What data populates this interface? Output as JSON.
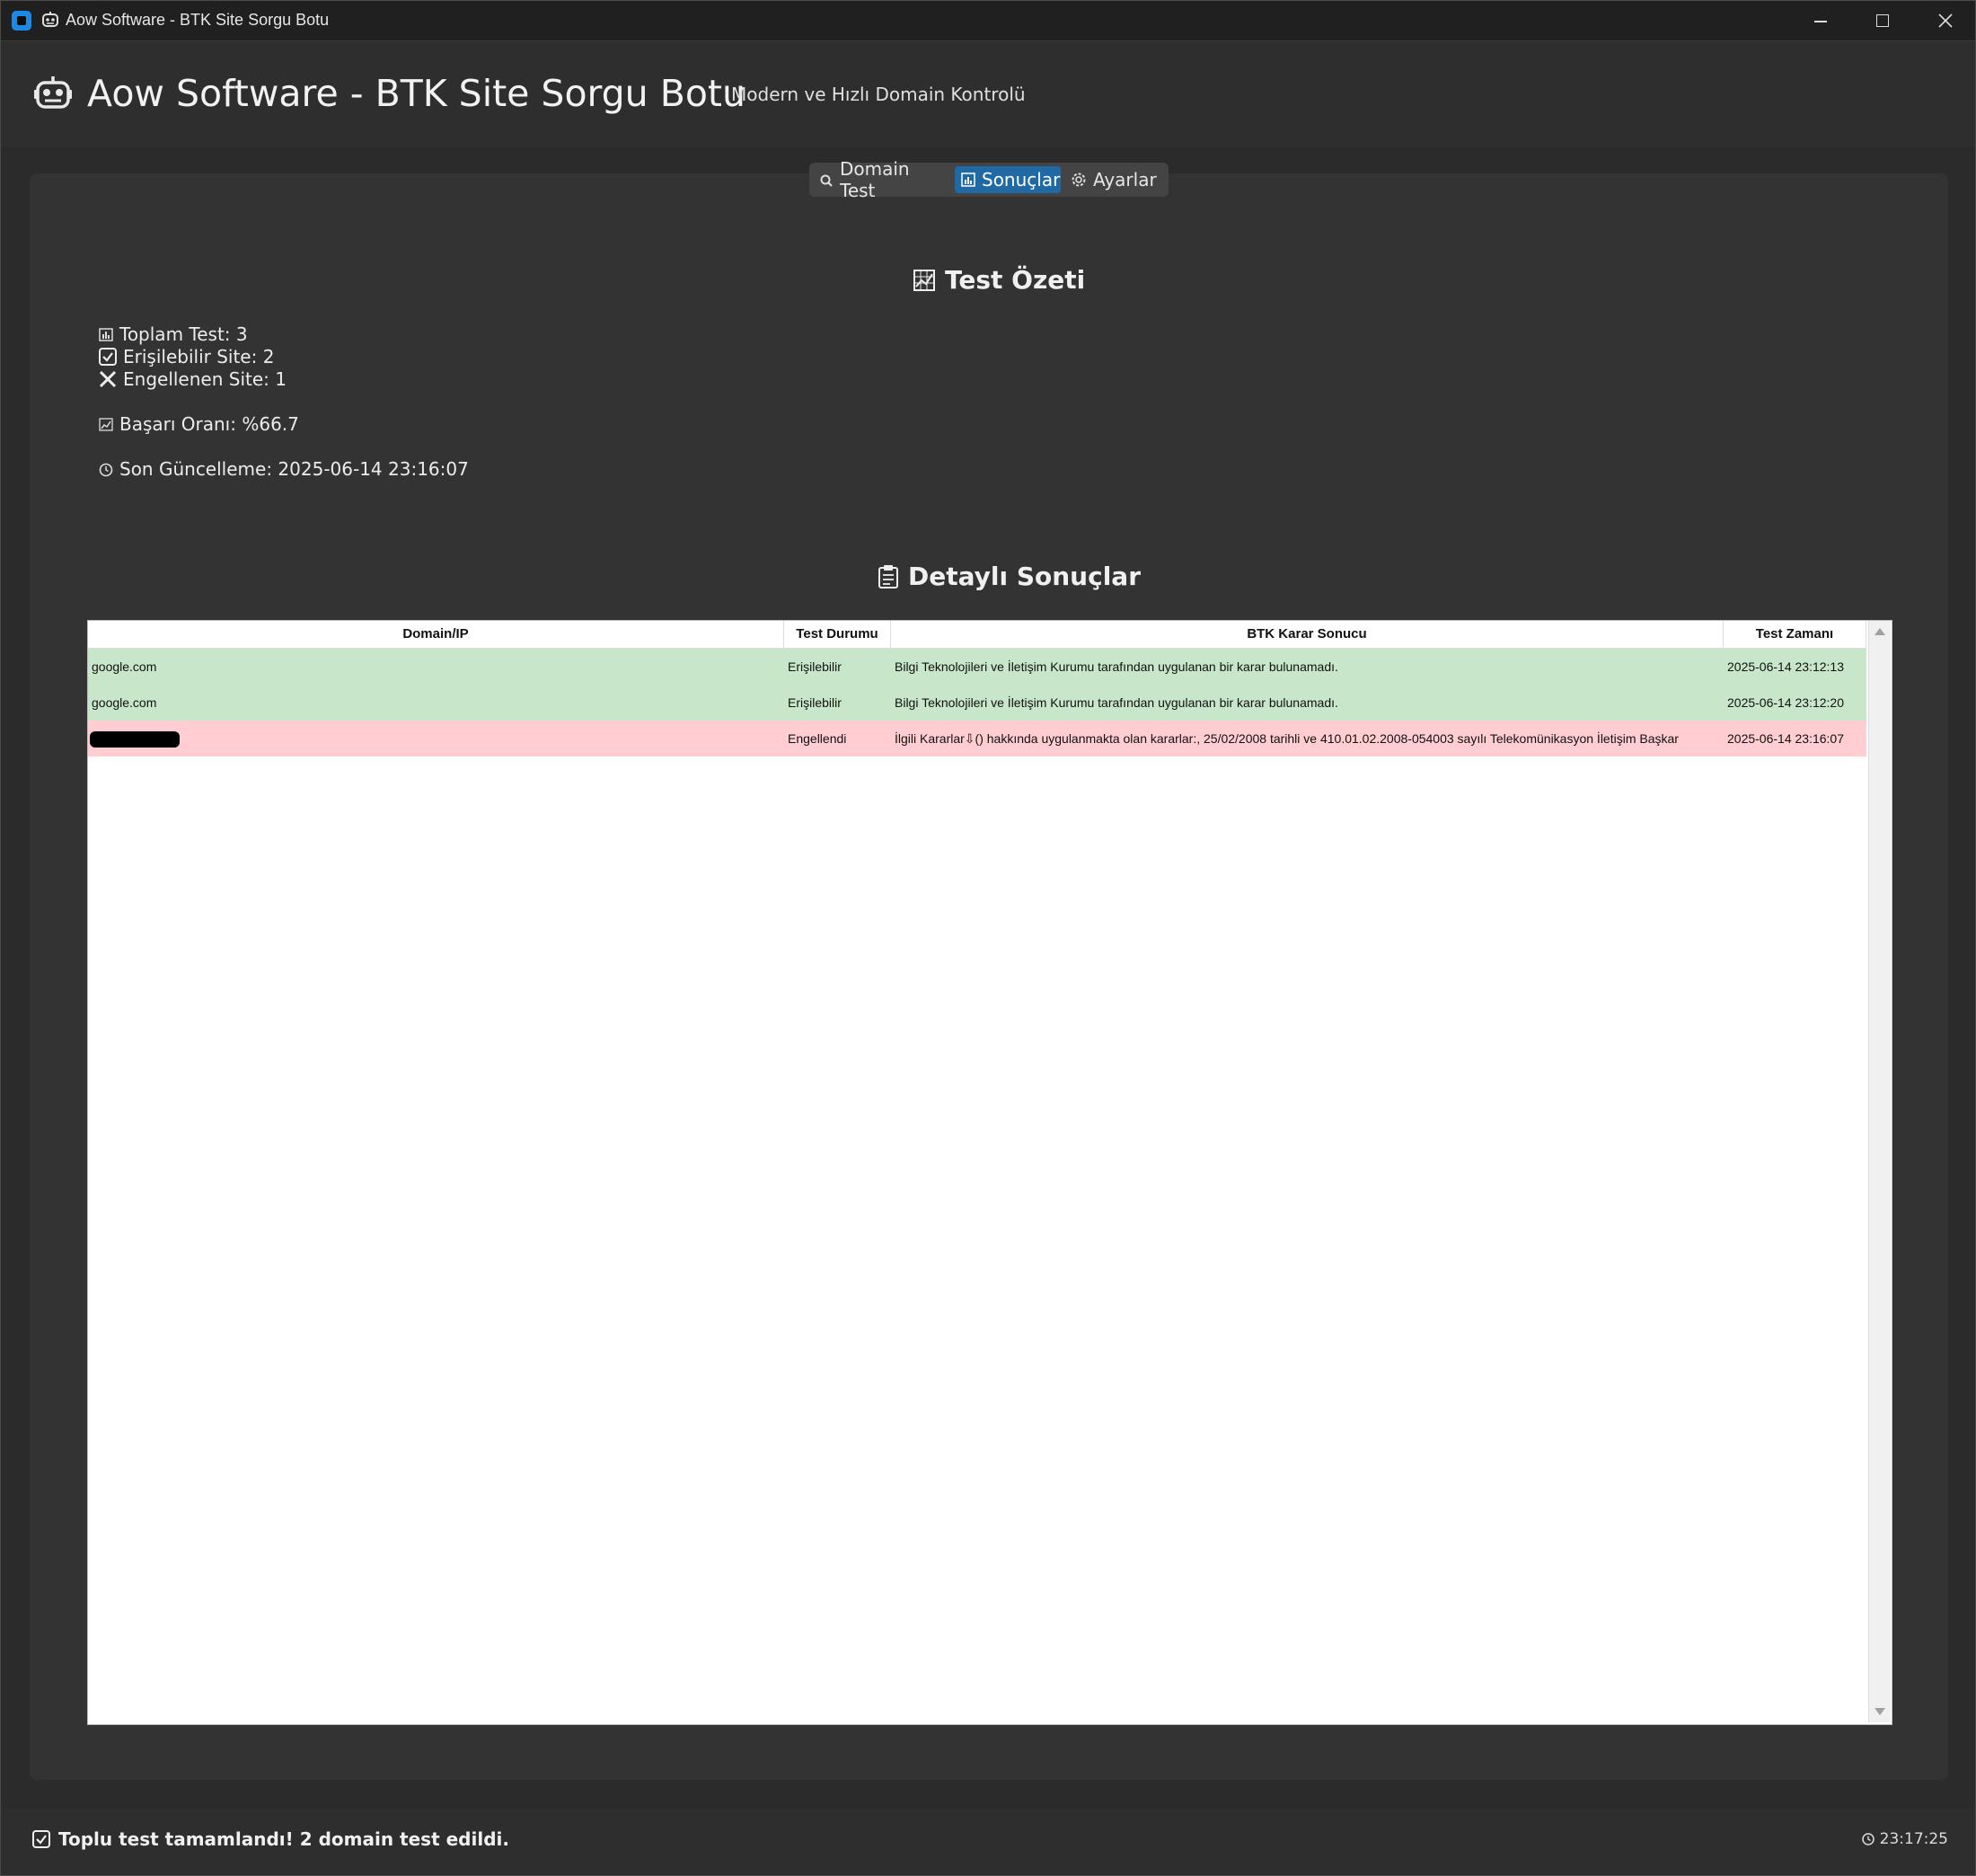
{
  "window": {
    "title": "Aow Software - BTK Site Sorgu Botu"
  },
  "header": {
    "title": "Aow Software - BTK Site Sorgu Botu",
    "subtitle": "Modern ve Hızlı Domain Kontrolü"
  },
  "tabs": [
    {
      "label": "Domain Test",
      "icon": "search-icon",
      "active": false
    },
    {
      "label": "Sonuçlar",
      "icon": "bar-chart-icon",
      "active": true
    },
    {
      "label": "Ayarlar",
      "icon": "gear-icon",
      "active": false
    }
  ],
  "summary": {
    "title": "Test Özeti",
    "total": "Toplam Test: 3",
    "accessible": "Erişilebilir Site: 2",
    "blocked": "Engellenen Site: 1",
    "success_rate": "Başarı Oranı: %66.7",
    "last_update": "Son Güncelleme: 2025-06-14 23:16:07"
  },
  "details": {
    "title": "Detaylı Sonuçlar",
    "columns": [
      "Domain/IP",
      "Test Durumu",
      "BTK Karar Sonucu",
      "Test Zamanı"
    ],
    "rows": [
      {
        "domain": "google.com",
        "status": "Erişilebilir",
        "result": "Bilgi Teknolojileri ve İletişim Kurumu tarafından uygulanan bir karar bulunamadı.",
        "time": "2025-06-14 23:12:13",
        "state": "ok"
      },
      {
        "domain": "google.com",
        "status": "Erişilebilir",
        "result": "Bilgi Teknolojileri ve İletişim Kurumu tarafından uygulanan bir karar bulunamadı.",
        "time": "2025-06-14 23:12:20",
        "state": "ok"
      },
      {
        "domain": "",
        "status": "Engellendi",
        "result": "İlgili Kararlar⇩() hakkında uygulanmakta olan kararlar:, 25/02/2008 tarihli ve 410.01.02.2008-054003 sayılı Telekomünikasyon İletişim Başkar",
        "time": "2025-06-14 23:16:07",
        "state": "bad"
      }
    ]
  },
  "status": {
    "message": "Toplu test tamamlandı! 2 domain test edildi.",
    "clock": "23:17:25"
  },
  "colors": {
    "accent": "#1f6aa5",
    "ok_row": "#c8e6c9",
    "blocked_row": "#ffcdd2"
  }
}
